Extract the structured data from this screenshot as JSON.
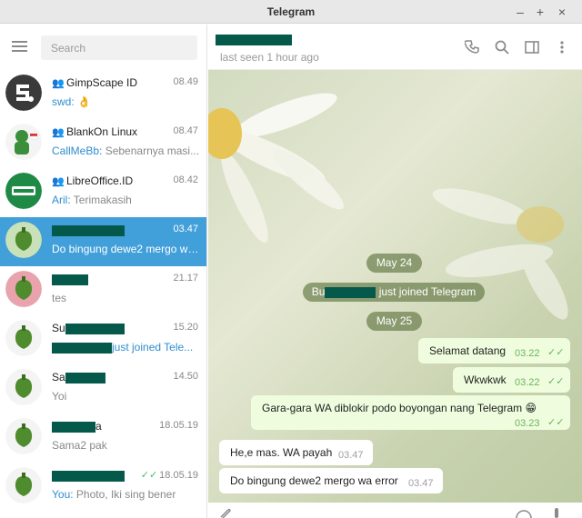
{
  "window": {
    "title": "Telegram",
    "buttons": [
      "–",
      "+",
      "×"
    ]
  },
  "sidebar": {
    "search_placeholder": "Search",
    "chats": [
      {
        "name": "GimpScape ID",
        "group": true,
        "time": "08.49",
        "sender": "swd:",
        "preview": " 👌"
      },
      {
        "name": "BlankOn Linux",
        "group": true,
        "time": "08.47",
        "sender": "CallMeBb:",
        "preview": " Sebenarnya masi..."
      },
      {
        "name": "LibreOffice.ID",
        "group": true,
        "time": "08.42",
        "sender": "Aril:",
        "preview": " Terimakasih"
      },
      {
        "name": "",
        "time": "03.47",
        "sender": "",
        "preview": "Do bingung dewe2 mergo wa...",
        "active": true
      },
      {
        "name": "",
        "time": "21.17",
        "sender": "",
        "preview": "tes"
      },
      {
        "name": "Su",
        "time": "15.20",
        "sender": "",
        "preview": "just joined Tele..."
      },
      {
        "name": "Sa",
        "time": "14.50",
        "sender": "",
        "preview": "Yoi"
      },
      {
        "name": "a",
        "time": "18.05.19",
        "sender": "",
        "preview": "Sama2 pak"
      },
      {
        "name": "",
        "time": "18.05.19",
        "sender": "You:",
        "preview": " Photo, Iki sing bener",
        "read": true
      }
    ]
  },
  "chat": {
    "status": "last seen 1 hour ago",
    "service": [
      {
        "text": "May 24"
      },
      {
        "prefix": "Bu",
        "text": " just joined Telegram"
      },
      {
        "text": "May 25"
      }
    ],
    "messages": [
      {
        "dir": "out",
        "text": "Selamat datang",
        "time": "03.22"
      },
      {
        "dir": "out",
        "text": "Wkwkwk",
        "time": "03.22"
      },
      {
        "dir": "out",
        "text": "Gara-gara WA diblokir podo boyongan nang Telegram 😁",
        "time": "03.23"
      },
      {
        "dir": "in",
        "text": "He,e mas. WA payah",
        "time": "03.47"
      },
      {
        "dir": "in",
        "text": "Do bingung dewe2 mergo wa error",
        "time": "03.47"
      }
    ]
  },
  "colors": {
    "accent": "#419fd9",
    "out_bubble": "#effdde",
    "read_ticks": "#5fba5a",
    "redaction": "#04594b"
  },
  "icons": [
    "hamburger-icon",
    "group-icon",
    "phone-icon",
    "search-icon",
    "sidebar-toggle-icon",
    "more-vertical-icon",
    "attach-icon",
    "emoji-icon",
    "microphone-icon"
  ]
}
